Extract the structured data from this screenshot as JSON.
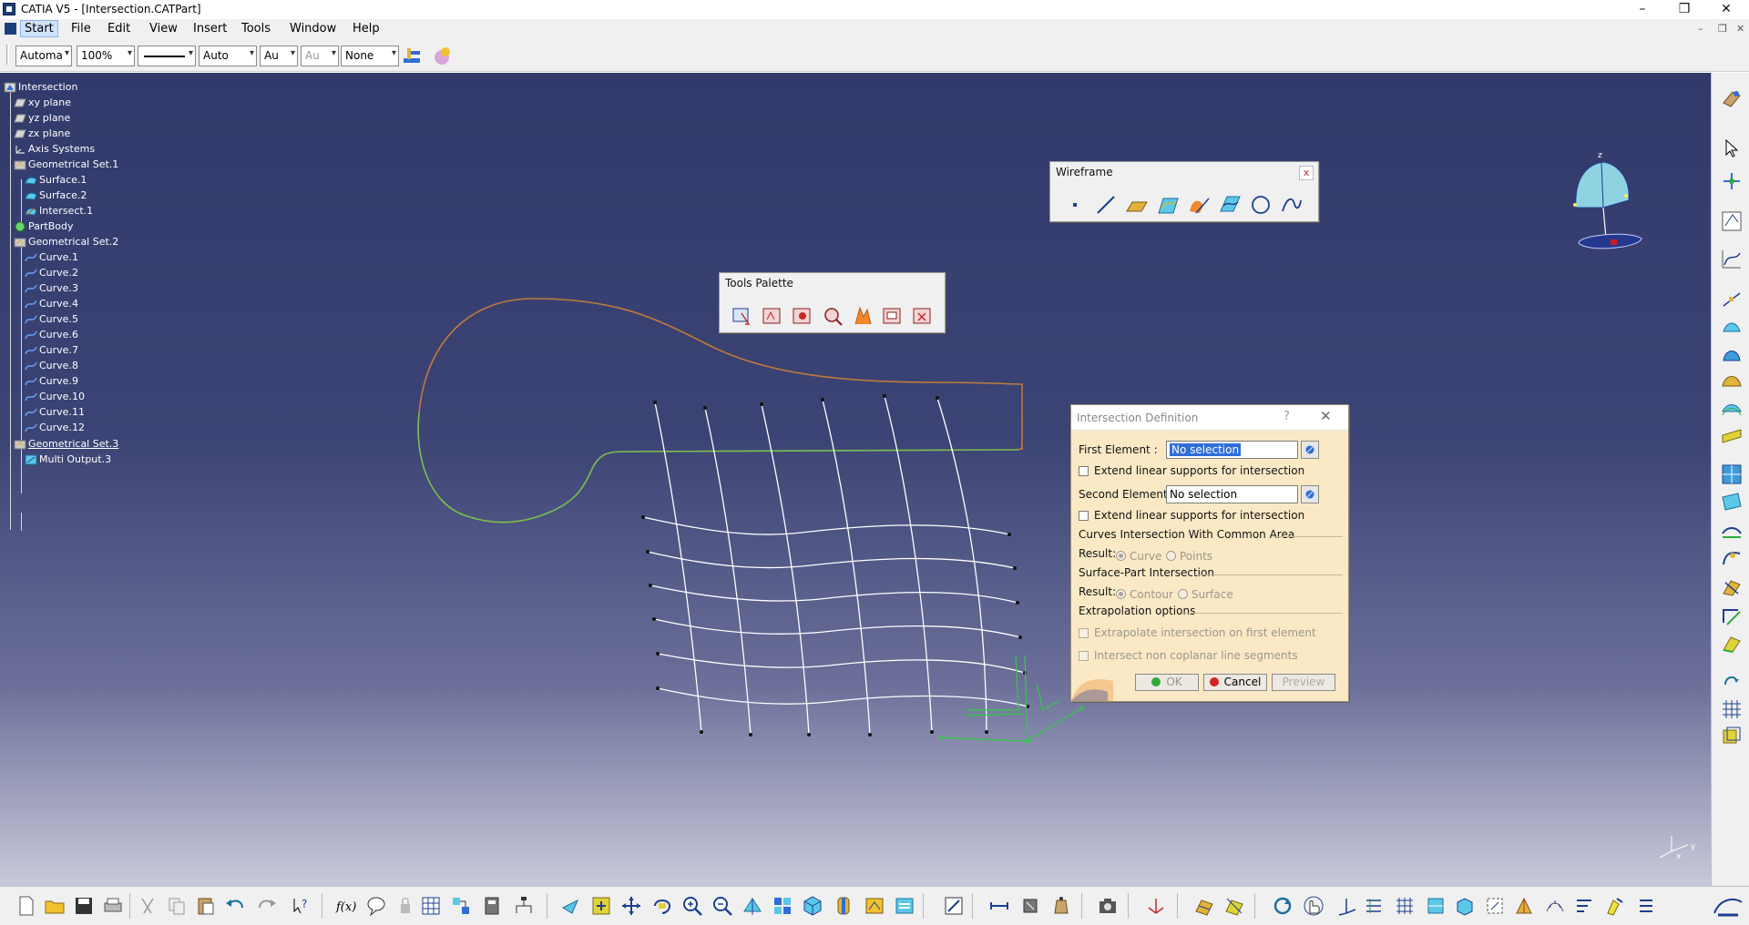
{
  "window": {
    "title": "CATIA V5 - [Intersection.CATPart]",
    "controls": [
      "minimize",
      "restore",
      "close"
    ]
  },
  "menu": {
    "items": [
      "Start",
      "File",
      "Edit",
      "View",
      "Insert",
      "Tools",
      "Window",
      "Help"
    ]
  },
  "property_toolbar": {
    "color": "Automa",
    "transparency": "100%",
    "line_weight_label": "",
    "line_type": "Auto",
    "layer_a": "Au",
    "layer_b": "Au",
    "render_style": "None"
  },
  "tree": {
    "nodes": [
      {
        "label": "Intersection",
        "icon": "part-icon"
      },
      {
        "label": "xy plane",
        "icon": "plane-icon"
      },
      {
        "label": "yz plane",
        "icon": "plane-icon"
      },
      {
        "label": "zx plane",
        "icon": "plane-icon"
      },
      {
        "label": "Axis Systems",
        "icon": "axis-system-icon"
      },
      {
        "label": "Geometrical Set.1",
        "icon": "geometrical-set-icon"
      },
      {
        "label": "Surface.1",
        "icon": "surface-icon"
      },
      {
        "label": "Surface.2",
        "icon": "surface-icon"
      },
      {
        "label": "Intersect.1",
        "icon": "intersect-icon"
      },
      {
        "label": "PartBody",
        "icon": "partbody-icon"
      },
      {
        "label": "Geometrical Set.2",
        "icon": "geometrical-set-icon"
      },
      {
        "label": "Curve.1",
        "icon": "curve-icon"
      },
      {
        "label": "Curve.2",
        "icon": "curve-icon"
      },
      {
        "label": "Curve.3",
        "icon": "curve-icon"
      },
      {
        "label": "Curve.4",
        "icon": "curve-icon"
      },
      {
        "label": "Curve.5",
        "icon": "curve-icon"
      },
      {
        "label": "Curve.6",
        "icon": "curve-icon"
      },
      {
        "label": "Curve.7",
        "icon": "curve-icon"
      },
      {
        "label": "Curve.8",
        "icon": "curve-icon"
      },
      {
        "label": "Curve.9",
        "icon": "curve-icon"
      },
      {
        "label": "Curve.10",
        "icon": "curve-icon"
      },
      {
        "label": "Curve.11",
        "icon": "curve-icon"
      },
      {
        "label": "Curve.12",
        "icon": "curve-icon"
      },
      {
        "label": "Geometrical Set.3",
        "icon": "geometrical-set-icon"
      },
      {
        "label": "Multi Output.3",
        "icon": "multi-output-icon"
      }
    ]
  },
  "wireframe_palette": {
    "title": "Wireframe",
    "close": "x",
    "tools": [
      "point-icon",
      "line-icon",
      "plane-icon",
      "projection-icon",
      "intersection-icon",
      "offset-curve-icon",
      "circle-icon",
      "spline-icon"
    ]
  },
  "tools_palette": {
    "title": "Tools Palette",
    "tools": [
      "select-tool-icon",
      "edit-list-icon",
      "clear-selection-icon",
      "search-selection-icon",
      "feature-order-icon",
      "list-add-icon",
      "list-remove-icon"
    ]
  },
  "dialog": {
    "title": "Intersection Definition",
    "help": "?",
    "close": "✕",
    "first_element_label": "First Element :",
    "first_element_value": "No selection",
    "extend_1": "Extend linear supports for intersection",
    "second_element_label": "Second Element :",
    "second_element_value": "No selection",
    "extend_2": "Extend linear supports for intersection",
    "curves_section": "Curves Intersection With Common Area",
    "result_label": "Result:",
    "curve_option": "Curve",
    "points_option": "Points",
    "surface_section": "Surface-Part Intersection",
    "contour_option": "Contour",
    "surface_option": "Surface",
    "extrapolation_section": "Extrapolation options",
    "extrapolate_first": "Extrapolate intersection on first element",
    "intersect_noncoplanar": "Intersect non coplanar line segments",
    "ok": "OK",
    "cancel": "Cancel",
    "preview": "Preview"
  },
  "colors": {
    "viewport_top": "#323a6b",
    "viewport_bottom": "#c8c9da",
    "orange_curve": "#c07a3c",
    "green_curve": "#7bbf4e",
    "grid_curve": "#ffffff",
    "axis_green": "#2ecc40",
    "dialog_bg": "#fbe9c6"
  },
  "compass_axis_labels": {
    "x": "x",
    "y": "y",
    "z": "z"
  }
}
